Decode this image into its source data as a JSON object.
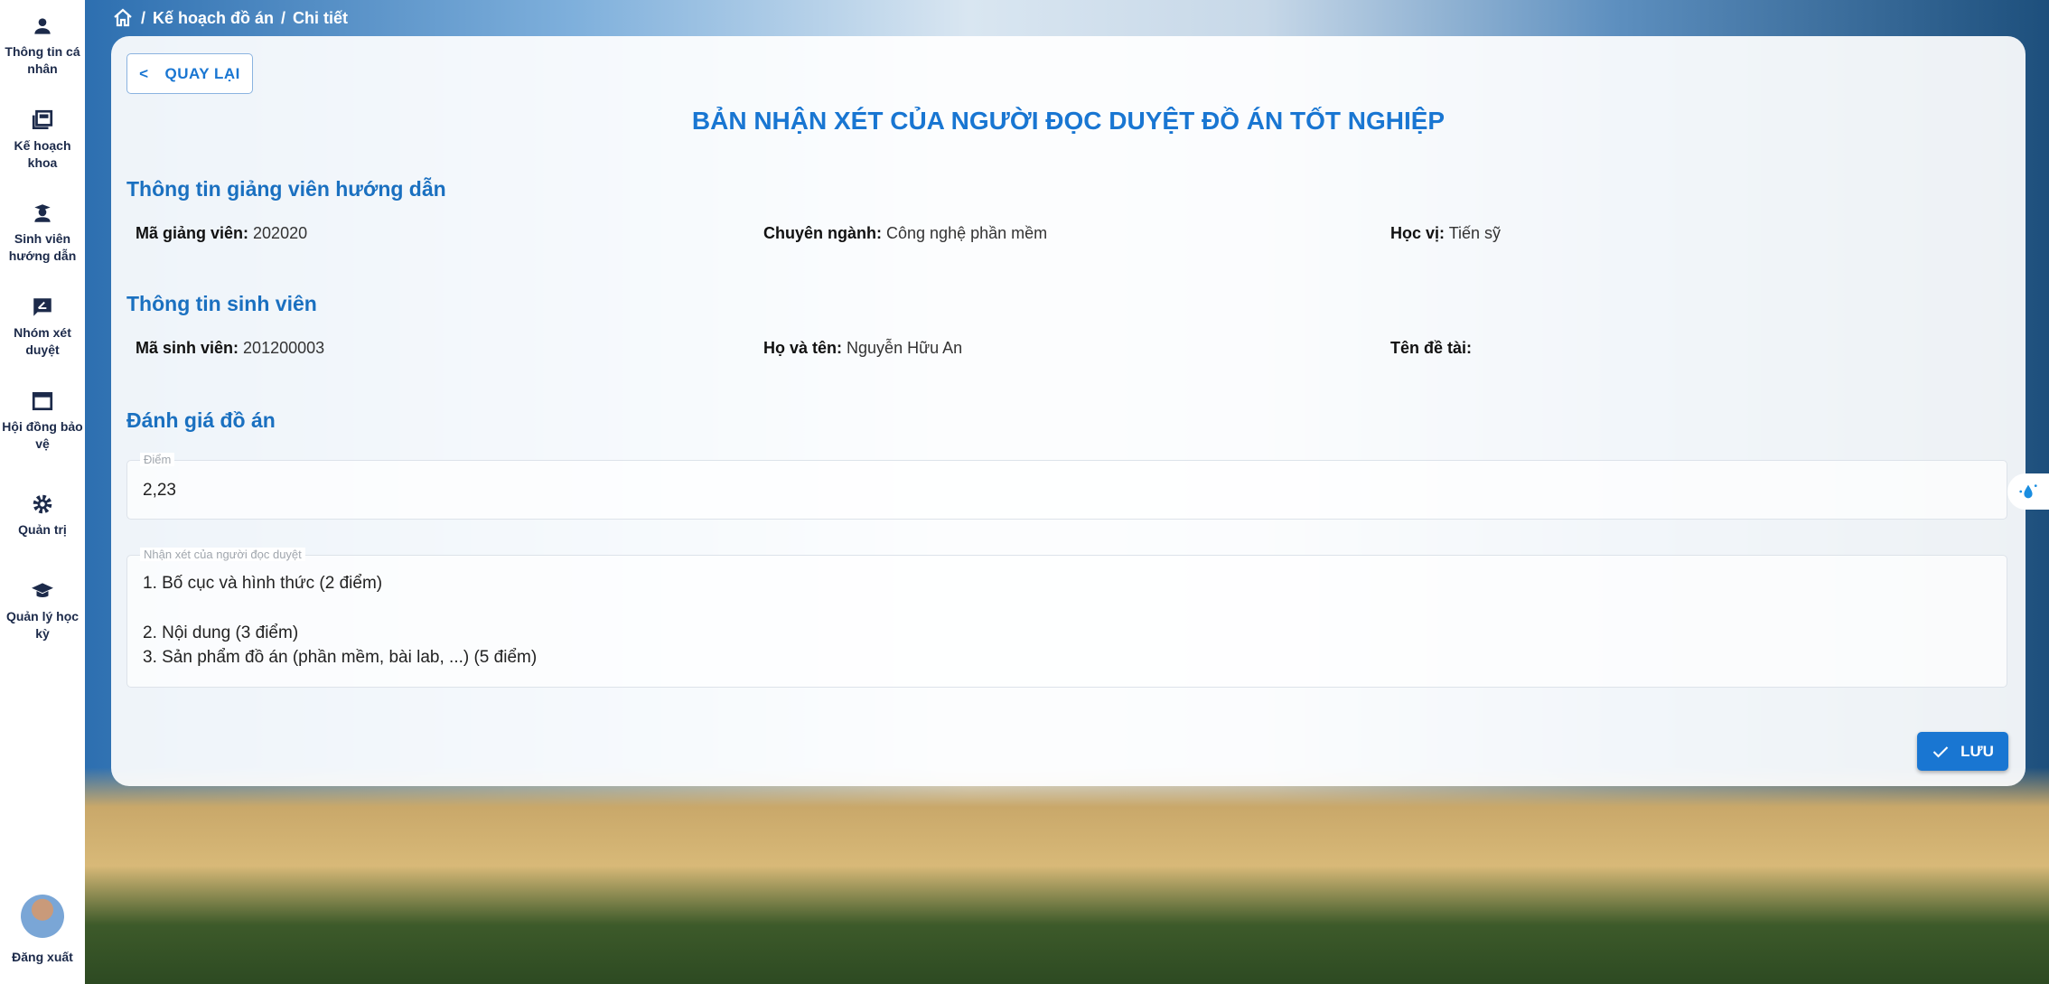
{
  "sidebar": {
    "items": [
      {
        "label": "Thông tin cá nhân",
        "icon": "person-icon"
      },
      {
        "label": "Kế hoạch khoa",
        "icon": "newspaper-icon"
      },
      {
        "label": "Sinh viên hướng dẫn",
        "icon": "student-icon"
      },
      {
        "label": "Nhóm xét duyệt",
        "icon": "review-icon"
      },
      {
        "label": "Hội đồng bảo vệ",
        "icon": "window-icon"
      },
      {
        "label": "Quản trị",
        "icon": "gear-icon"
      },
      {
        "label": "Quản lý học kỳ",
        "icon": "graduation-cap-icon"
      }
    ],
    "logout": "Đăng xuất"
  },
  "breadcrumb": {
    "items": [
      "Kế hoạch đồ án",
      "Chi tiết"
    ]
  },
  "back_label": "QUAY LẠI",
  "title": "BẢN NHẬN XÉT CỦA NGƯỜI ĐỌC DUYỆT ĐỒ ÁN TỐT NGHIỆP",
  "advisor": {
    "heading": "Thông tin giảng viên hướng dẫn",
    "id_label": "Mã giảng viên:",
    "id": "202020",
    "major_label": "Chuyên ngành:",
    "major": "Công nghệ phần mềm",
    "degree_label": "Học vị:",
    "degree": "Tiến sỹ"
  },
  "student": {
    "heading": "Thông tin sinh viên",
    "id_label": "Mã sinh viên:",
    "id": "201200003",
    "name_label": "Họ và tên:",
    "name": "Nguyễn Hữu An",
    "topic_label": "Tên đề tài:",
    "topic": ""
  },
  "evaluation": {
    "heading": "Đánh giá đồ án",
    "score_label": "Điểm",
    "score": "2,23",
    "comment_label": "Nhận xét của người đọc duyệt",
    "comment_lines": [
      "1. Bố cục và hình thức (2 điểm)",
      "2. Nội dung (3 điểm)",
      "3. Sản phẩm đồ án (phần mềm, bài lab, ...) (5 điểm)"
    ]
  },
  "save_label": "LƯU",
  "colors": {
    "primary": "#1976d2"
  }
}
